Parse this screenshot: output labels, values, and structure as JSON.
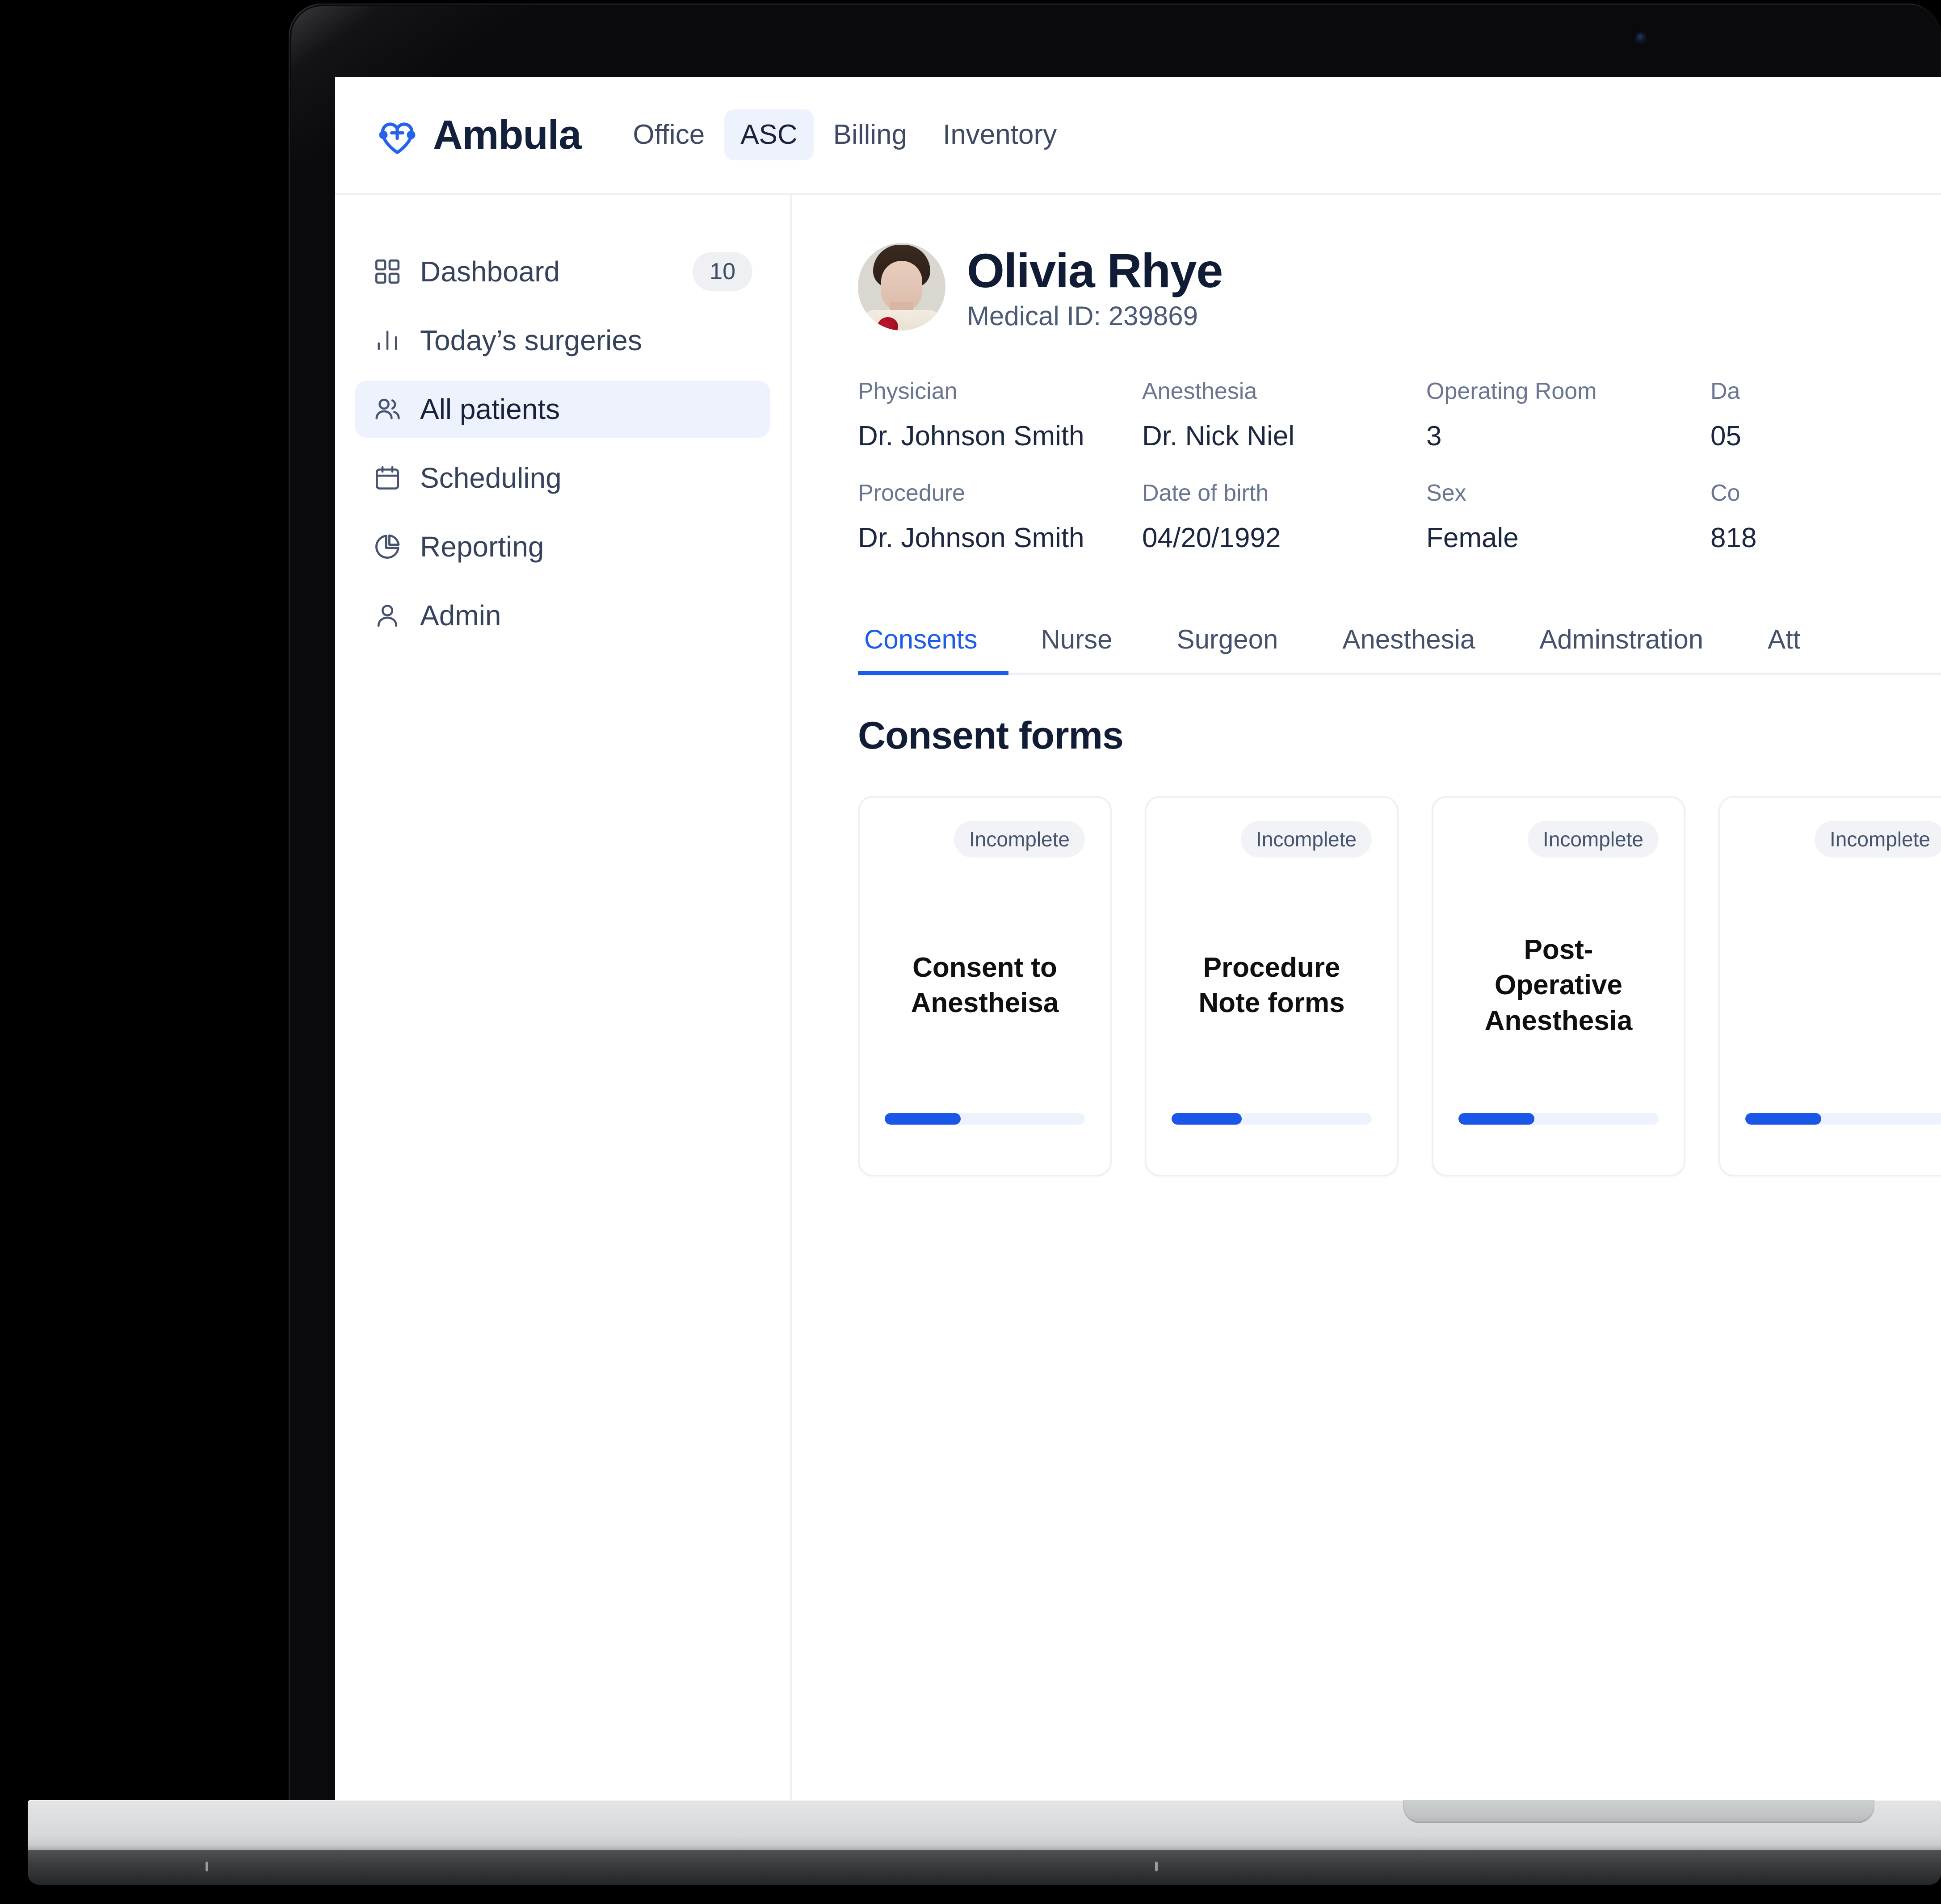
{
  "topnav": {
    "brand": "Ambula",
    "brand_logo_icon": "heart-plus-icon",
    "links": [
      {
        "label": "Office",
        "active": false
      },
      {
        "label": "ASC",
        "active": true
      },
      {
        "label": "Billing",
        "active": false
      },
      {
        "label": "Inventory",
        "active": false
      }
    ]
  },
  "sidebar": {
    "items": [
      {
        "label": "Dashboard",
        "icon": "grid-icon",
        "badge": "10",
        "active": false
      },
      {
        "label": "Today’s surgeries",
        "icon": "bar-chart-icon",
        "badge": null,
        "active": false
      },
      {
        "label": "All patients",
        "icon": "users-icon",
        "badge": null,
        "active": true
      },
      {
        "label": "Scheduling",
        "icon": "calendar-icon",
        "badge": null,
        "active": false
      },
      {
        "label": "Reporting",
        "icon": "pie-chart-icon",
        "badge": null,
        "active": false
      },
      {
        "label": "Admin",
        "icon": "user-icon",
        "badge": null,
        "active": false
      }
    ]
  },
  "patient": {
    "name": "Olivia Rhye",
    "medical_id_text": "Medical ID: 239869",
    "avatar_alt": "patient-photo",
    "fields": [
      {
        "label": "Physician",
        "value": "Dr. Johnson Smith"
      },
      {
        "label": "Anesthesia",
        "value": "Dr. Nick Niel"
      },
      {
        "label": "Operating Room",
        "value": "3"
      },
      {
        "label": "Da",
        "value": "05"
      },
      {
        "label": "Procedure",
        "value": "Dr. Johnson Smith"
      },
      {
        "label": "Date of birth",
        "value": "04/20/1992"
      },
      {
        "label": "Sex",
        "value": "Female"
      },
      {
        "label": "Co",
        "value": "818"
      }
    ]
  },
  "tabs": [
    {
      "label": "Consents",
      "active": true
    },
    {
      "label": "Nurse",
      "active": false
    },
    {
      "label": "Surgeon",
      "active": false
    },
    {
      "label": "Anesthesia",
      "active": false
    },
    {
      "label": "Adminstration",
      "active": false
    },
    {
      "label": "Att",
      "active": false
    }
  ],
  "consent_section": {
    "title": "Consent forms",
    "cards": [
      {
        "status": "Incomplete",
        "title": "Consent to Anestheisa",
        "progress_pct": 38
      },
      {
        "status": "Incomplete",
        "title": "Procedure Note forms",
        "progress_pct": 35
      },
      {
        "status": "Incomplete",
        "title": "Post-Operative Anesthesia",
        "progress_pct": 38
      },
      {
        "status": "Incomplete",
        "title": "",
        "progress_pct": 38
      }
    ]
  },
  "colors": {
    "accent_blue": "#1a56e8",
    "accent_blue_soft": "#eef2fd",
    "text_dark": "#101c35",
    "text_muted": "#69768f",
    "border": "#eef0f4",
    "badge_gray": "#f1f3f7"
  }
}
